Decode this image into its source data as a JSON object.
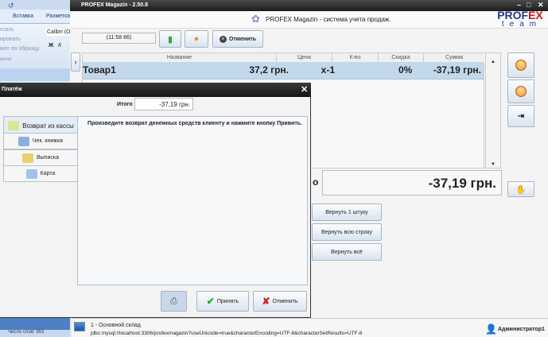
{
  "background_app": {
    "tabs": [
      "Вставка",
      "Разметка"
    ],
    "font_box": "Calibri (О",
    "items": [
      "езать",
      "ировать",
      "мат по образцу",
      "мена"
    ],
    "bold": "Ж",
    "italic": "К",
    "status": "Число слов: 953"
  },
  "window": {
    "title": "PROFEX Magazin - 2.50.8",
    "header": "PROFEX Magazin - система учета продаж.",
    "logo_top": "PROF",
    "logo_top_accent": "EX",
    "logo_bottom": "team"
  },
  "toolbar": {
    "time": "(11:58 86)",
    "cancel": "Отменить"
  },
  "table": {
    "columns": [
      "Название",
      "Цена",
      "К-во",
      "Скидка",
      "Сумма"
    ],
    "rows": [
      {
        "name": "Товар1",
        "price": "37,2 грн.",
        "qty": "x-1",
        "discount": "0%",
        "sum": "-37,19 грн."
      }
    ]
  },
  "total": {
    "label": "о",
    "value": "-37,19 грн."
  },
  "return_buttons": [
    "Вернуть 1 штуку",
    "Вернуть всю строку",
    "Вернуть всё"
  ],
  "dialog": {
    "title": "Платёж",
    "total_label": "Итого",
    "total_value": "-37,19 грн.",
    "tabs": [
      "Возврат из кассы",
      "Чек. книжка",
      "Выписка",
      "Карта"
    ],
    "message": "Произведите возврат денежных средств клиенту и нажмите кнопку Привить.",
    "accept": "Принять",
    "cancel": "Отменить"
  },
  "statusbar": {
    "store": "1 - Основной склад",
    "connection": "jdbc:mysql://localhost:3306/profexmagazin?useUnicode=true&characterEncoding=UTF-8&characterSetResults=UTF-8",
    "user": "Администратор1"
  }
}
